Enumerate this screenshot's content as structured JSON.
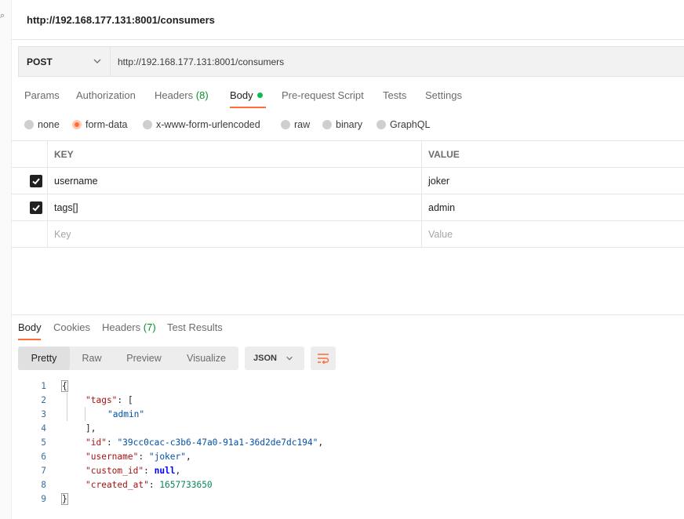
{
  "app": {
    "edge_glyph": "⌕",
    "title": "http://192.168.177.131:8001/consumers"
  },
  "request": {
    "method": "POST",
    "url": "http://192.168.177.131:8001/consumers",
    "tabs": [
      {
        "label": "Params"
      },
      {
        "label": "Authorization"
      },
      {
        "label": "Headers",
        "count": "(8)"
      },
      {
        "label": "Body",
        "active": true
      },
      {
        "label": "Pre-request Script"
      },
      {
        "label": "Tests"
      },
      {
        "label": "Settings"
      }
    ],
    "body_types": [
      "none",
      "form-data",
      "x-www-form-urlencoded",
      "raw",
      "binary",
      "GraphQL"
    ],
    "selected_body_type": "form-data",
    "table": {
      "headers": {
        "key": "KEY",
        "value": "VALUE"
      },
      "rows": [
        {
          "key": "username",
          "value": "joker",
          "checked": true
        },
        {
          "key": "tags[]",
          "value": "admin",
          "checked": true
        }
      ],
      "placeholder": {
        "key": "Key",
        "value": "Value"
      }
    }
  },
  "response": {
    "tabs": [
      {
        "label": "Body",
        "active": true
      },
      {
        "label": "Cookies"
      },
      {
        "label": "Headers",
        "count": "(7)"
      },
      {
        "label": "Test Results"
      }
    ],
    "view_modes": [
      "Pretty",
      "Raw",
      "Preview",
      "Visualize"
    ],
    "active_view": "Pretty",
    "format": "JSON",
    "code": {
      "line_numbers": [
        "1",
        "2",
        "3",
        "4",
        "5",
        "6",
        "7",
        "8",
        "9"
      ],
      "open_brace": "{",
      "tags_key": "\"tags\"",
      "tags_open": ": [",
      "tags_value": "\"admin\"",
      "tags_close": "],",
      "id_key": "\"id\"",
      "id_value": "\"39cc0cac-c3b6-47a0-91a1-36d2de7dc194\"",
      "username_key": "\"username\"",
      "username_value": "\"joker\"",
      "custom_id_key": "\"custom_id\"",
      "custom_id_value": "null",
      "created_at_key": "\"created_at\"",
      "created_at_value": "1657733650",
      "close_brace": "}",
      "colon": ": ",
      "comma": ","
    }
  },
  "colors": {
    "accent": "#ff6c37",
    "success": "#0cbb52",
    "count": "#0c8d2f"
  }
}
